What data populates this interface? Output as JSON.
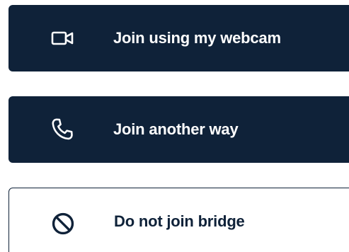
{
  "colors": {
    "button_dark": "#0f2239",
    "button_text_light": "#ffffff",
    "outline": "#0f2239"
  },
  "options": [
    {
      "label": "Join using my webcam",
      "icon": "video-camera-icon"
    },
    {
      "label": "Join another way",
      "icon": "phone-icon"
    },
    {
      "label": "Do not join bridge",
      "icon": "prohibited-icon"
    }
  ]
}
